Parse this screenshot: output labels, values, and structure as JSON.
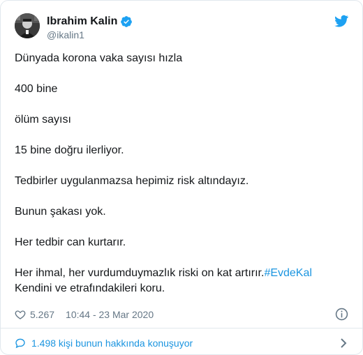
{
  "author": {
    "display_name": "Ibrahim Kalin",
    "handle": "@ikalin1",
    "verified": true
  },
  "tweet": {
    "paragraphs": [
      "Dünyada korona vaka sayısı hızla",
      "400 bine",
      "ölüm sayısı",
      "15 bine doğru ilerliyor.",
      "Tedbirler uygulanmazsa hepimiz risk altındayız.",
      "Bunun şakası yok.",
      "Her tedbir can kurtarır."
    ],
    "last_paragraph": {
      "text_before": "Her ihmal, her vurdumduymazlık riski on kat artırır.",
      "hashtag": "#EvdeKal",
      "line2": "Kendini ve etrafındakileri koru."
    }
  },
  "meta": {
    "likes": "5.267",
    "timestamp": "10:44 - 23 Mar 2020"
  },
  "footer": {
    "conversation_label": "1.498 kişi bunun hakkında konuşuyor"
  },
  "colors": {
    "twitter_blue": "#1da1f2",
    "link_blue": "#1b95e0",
    "secondary_text": "#657786",
    "border": "#e1e8ed"
  },
  "icons": {
    "avatar": "profile-photo",
    "verified": "verified-badge-icon",
    "brand": "twitter-bird-icon",
    "like": "heart-icon",
    "info": "info-icon",
    "conversation": "speech-bubble-icon",
    "chevron": "chevron-right-icon"
  }
}
